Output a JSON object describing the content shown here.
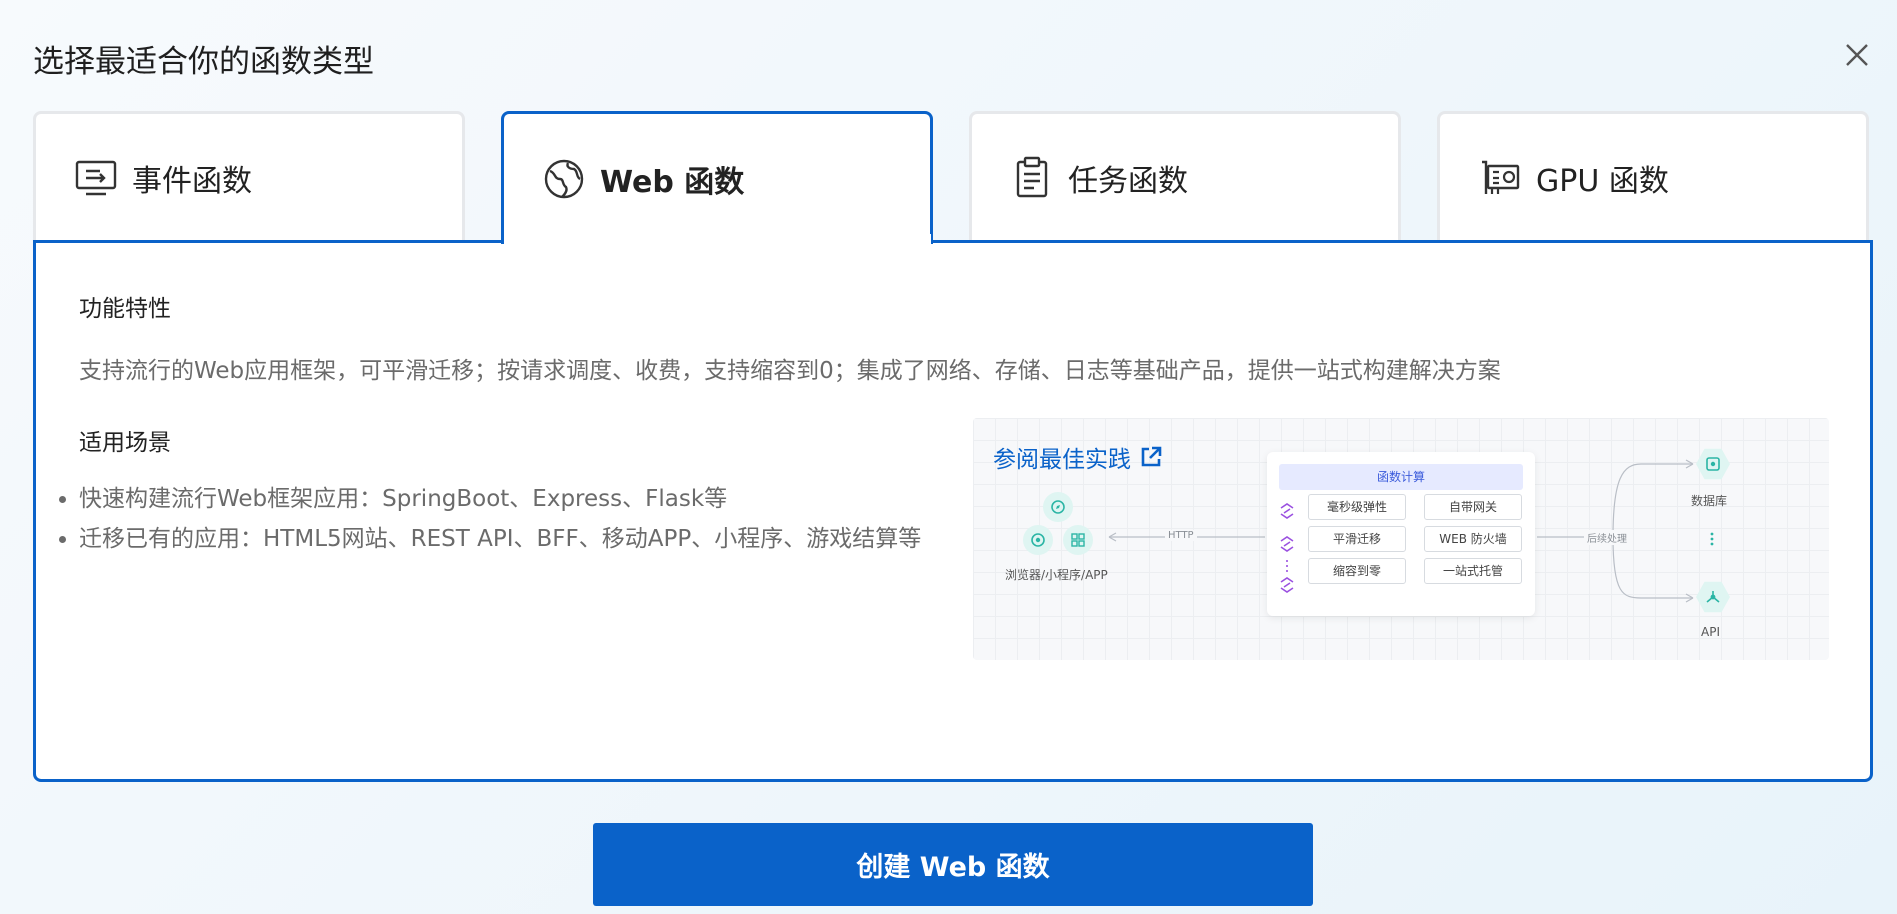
{
  "dialog": {
    "title": "选择最适合你的函数类型"
  },
  "tabs": [
    {
      "label": "事件函数",
      "icon": "event-function-icon",
      "active": false
    },
    {
      "label": "Web 函数",
      "icon": "web-globe-icon",
      "active": true
    },
    {
      "label": "任务函数",
      "icon": "clipboard-task-icon",
      "active": false
    },
    {
      "label": "GPU 函数",
      "icon": "gpu-card-icon",
      "active": false
    }
  ],
  "panel": {
    "features_heading": "功能特性",
    "features_text": "支持流行的Web应用框架，可平滑迁移；按请求调度、收费，支持缩容到0；集成了网络、存储、日志等基础产品，提供一站式构建解决方案",
    "scenarios_heading": "适用场景",
    "scenarios": [
      "快速构建流行Web框架应用：SpringBoot、Express、Flask等",
      "迁移已有的应用：HTML5网站、REST API、BFF、移动APP、小程序、游戏结算等"
    ]
  },
  "diagram": {
    "practice_link": "参阅最佳实践",
    "client_label": "浏览器/小程序/APP",
    "http_label": "HTTP",
    "core_title": "函数计算",
    "chips": [
      "毫秒级弹性",
      "自带网关",
      "平滑迁移",
      "WEB 防火墙",
      "缩容到零",
      "一站式托管"
    ],
    "backend_label": "后续处理",
    "db_label": "数据库",
    "api_label": "API",
    "colors": {
      "accent": "#0a62c9",
      "teal": "#2bb5a5",
      "purple": "#9b51e0"
    }
  },
  "footer": {
    "create_button": "创建 Web 函数"
  }
}
